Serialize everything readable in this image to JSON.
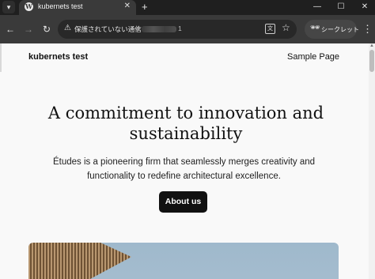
{
  "browser": {
    "tab": {
      "title": "kubernets test",
      "favicon": "wordpress-icon"
    },
    "new_tab_label": "+",
    "window_controls": {
      "minimize": "—",
      "maximize": "☐",
      "close": "✕"
    },
    "toolbar": {
      "security_text": "保護されていない通信",
      "url_prefix": "4",
      "url_suffix": "1",
      "incognito_label": "シークレット"
    }
  },
  "page": {
    "site_title": "kubernets test",
    "nav": [
      "Sample Page"
    ],
    "hero": {
      "heading": "A commitment to innovation and sustainability",
      "text": "Études is a pioneering firm that seamlessly merges creativity and functionality to redefine architectural excellence.",
      "button_label": "About us"
    }
  }
}
